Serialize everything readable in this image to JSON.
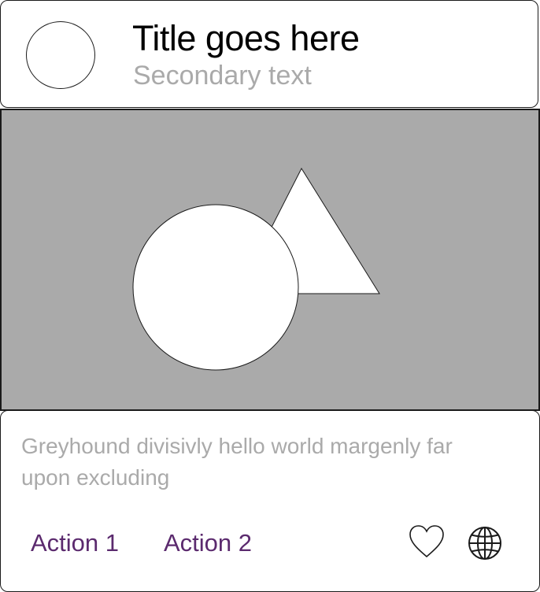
{
  "header": {
    "title": "Title goes here",
    "subtitle": "Secondary text"
  },
  "media": {
    "background_color": "#aaaaaa",
    "shapes": [
      "circle",
      "triangle"
    ]
  },
  "body": {
    "description": "Greyhound divisivly hello world margenly far upon excluding"
  },
  "actions": {
    "action_1": "Action 1",
    "action_2": "Action 2",
    "accent_color": "#5b2a6e",
    "icons": [
      "heart-icon",
      "globe-icon"
    ]
  }
}
